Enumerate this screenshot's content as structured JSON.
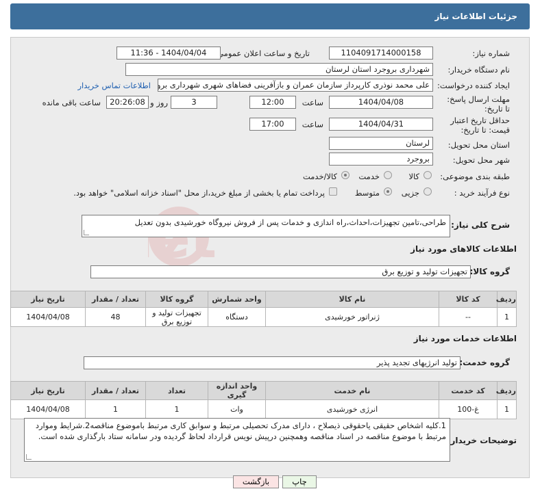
{
  "header": {
    "title": "جزئیات اطلاعات نیاز"
  },
  "form": {
    "need_number_label": "شماره نیاز:",
    "need_number": "1104091714000158",
    "announce_label": "تاریخ و ساعت اعلان عمومی:",
    "announce_value": "1404/04/04 - 11:36",
    "buyer_org_label": "نام دستگاه خریدار:",
    "buyer_org": "شهرداری بروجرد استان لرستان",
    "creator_label": "ایجاد کننده درخواست:",
    "creator": "علی محمد نوذری کارپرداز سازمان عمران و بازآفرینی فضاهای شهری شهرداری بروجرد",
    "contact_link": "اطلاعات تماس خریدار",
    "deadline_label": "مهلت ارسال پاسخ: تا تاریخ:",
    "deadline_date": "1404/04/08",
    "time_label": "ساعت",
    "deadline_time": "12:00",
    "days_value": "3",
    "days_label": "روز و",
    "remaining_time": "20:26:08",
    "remaining_label": "ساعت باقی مانده",
    "validity_label": "حداقل تاریخ اعتبار قیمت: تا تاریخ:",
    "validity_date": "1404/04/31",
    "validity_time": "17:00",
    "province_label": "استان محل تحویل:",
    "province": "لرستان",
    "city_label": "شهر محل تحویل:",
    "city": "بروجرد",
    "category_label": "طبقه بندی موضوعی:",
    "category_options": [
      "کالا",
      "خدمت",
      "کالا/خدمت"
    ],
    "process_label": "نوع فرآیند خرید :",
    "process_options": [
      "جزیی",
      "متوسط"
    ],
    "payment_note": "پرداخت تمام یا بخشی از مبلغ خرید،از محل \"اسناد خزانه اسلامی\" خواهد بود.",
    "description_label": "شرح کلی نیاز:",
    "description": "طراحی،تامین تجهیزات،احداث،راه اندازی و خدمات پس از فروش نیروگاه خورشیدی بدون تعدیل"
  },
  "goods": {
    "section_title": "اطلاعات کالاهای مورد نیاز",
    "group_label": "گروه کالا:",
    "group_value": "تجهیزات تولید و توزیع برق",
    "columns": [
      "ردیف",
      "کد کالا",
      "نام کالا",
      "واحد شمارش",
      "گروه کالا",
      "تعداد / مقدار",
      "تاریخ نیاز"
    ],
    "rows": [
      [
        "1",
        "--",
        "ژنراتور خورشیدی",
        "دستگاه",
        "تجهیزات تولید و توزیع برق",
        "48",
        "1404/04/08"
      ]
    ]
  },
  "services": {
    "section_title": "اطلاعات خدمات مورد نیاز",
    "group_label": "گروه خدمت:",
    "group_value": "تولید انرژیهای تجدید پذیر",
    "columns": [
      "ردیف",
      "کد خدمت",
      "نام خدمت",
      "واحد اندازه گیری",
      "تعداد",
      "تعداد / مقدار",
      "تاریخ نیاز"
    ],
    "rows": [
      [
        "1",
        "غ-100",
        "انرژی خورشیدی",
        "وات",
        "1",
        "1",
        "1404/04/08"
      ]
    ]
  },
  "buyer_notes": {
    "label": "توضیحات خریدار:",
    "text": "1.کلیه اشخاص حقیقی یاحقوقی ذیصلاح ، دارای مدرک تحصیلی مرتبط و سوابق کاری مرتبط باموضوع مناقصه2.شرایط وموارد مرتبط با موضوع مناقصه در اسناد مناقصه وهمچنین درپیش نویس قرارداد لحاظ گردیده ودر سامانه ستاد بارگذاری شده است."
  },
  "buttons": {
    "print": "چاپ",
    "back": "بازگشت"
  },
  "colors": {
    "header": "#3d6f9c",
    "back_button": "#fbe4e4",
    "print_button": "#eaf7e6",
    "link": "#1f5fb0"
  }
}
